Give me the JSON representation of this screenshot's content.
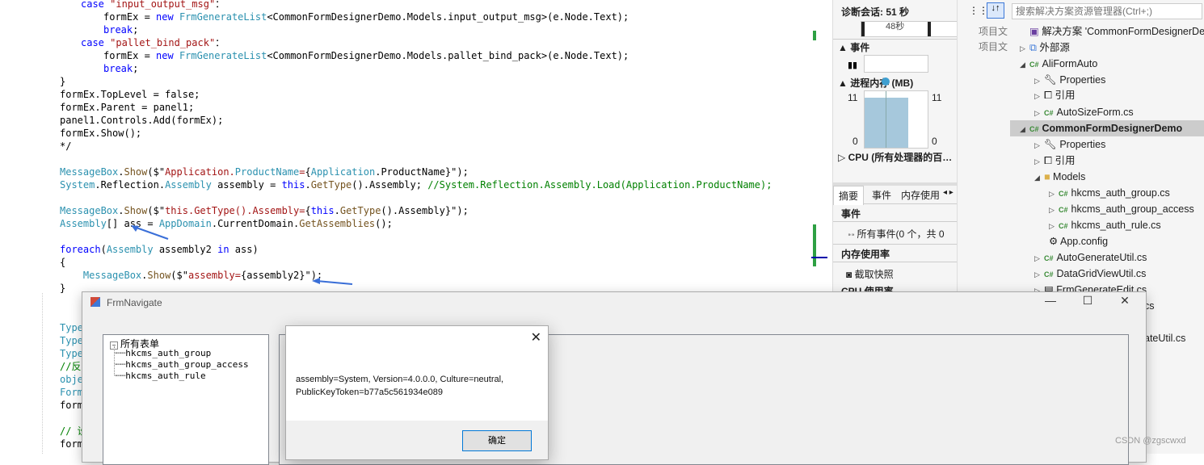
{
  "editor": {
    "lines": [
      {
        "segments": [
          [
            "kw",
            "case "
          ],
          [
            "st",
            "\"input_output_msg\""
          ],
          [
            "",
            "："
          ]
        ]
      },
      {
        "segments": [
          [
            "",
            "formEx = "
          ],
          [
            "kw",
            "new "
          ],
          [
            "ty",
            "FrmGenerateList"
          ],
          [
            "",
            "<CommonFormDesignerDemo.Models.input_output_msg>(e.Node.Text);"
          ]
        ]
      },
      {
        "segments": [
          [
            "kw",
            "break"
          ],
          [
            "",
            ";"
          ]
        ]
      },
      {
        "segments": [
          [
            "kw",
            "case "
          ],
          [
            "st",
            "\"pallet_bind_pack\""
          ],
          [
            "",
            "："
          ]
        ]
      },
      {
        "segments": [
          [
            "",
            "formEx = "
          ],
          [
            "kw",
            "new "
          ],
          [
            "ty",
            "FrmGenerateList"
          ],
          [
            "",
            "<CommonFormDesignerDemo.Models.pallet_bind_pack>(e.Node.Text);"
          ]
        ]
      },
      {
        "segments": [
          [
            "kw",
            "break"
          ],
          [
            "",
            ";"
          ]
        ]
      },
      {
        "segments": [
          [
            "",
            "}"
          ]
        ]
      },
      {
        "segments": [
          [
            "",
            "formEx.TopLevel = false;"
          ]
        ]
      },
      {
        "segments": [
          [
            "",
            "formEx.Parent = panel1;"
          ]
        ]
      },
      {
        "segments": [
          [
            "",
            "panel1.Controls.Add(formEx);"
          ]
        ]
      },
      {
        "segments": [
          [
            "",
            "formEx.Show();"
          ]
        ]
      },
      {
        "segments": [
          [
            "",
            "*/"
          ]
        ]
      },
      {
        "segments": [
          [
            "",
            ""
          ]
        ]
      },
      {
        "segments": [
          [
            "ty",
            "MessageBox"
          ],
          [
            "",
            "."
          ],
          [
            "fn",
            "Show"
          ],
          [
            "",
            "($\""
          ],
          [
            "st",
            "Application."
          ],
          [
            "ty",
            "ProductName"
          ],
          [
            "st",
            "="
          ],
          [
            "",
            "{"
          ],
          [
            "ty",
            "Application"
          ],
          [
            "",
            ".ProductName}\");"
          ]
        ]
      },
      {
        "segments": [
          [
            "ty",
            "System"
          ],
          [
            "",
            ".Reflection."
          ],
          [
            "ty",
            "Assembly"
          ],
          [
            "",
            " assembly = "
          ],
          [
            "kw",
            "this"
          ],
          [
            "",
            "."
          ],
          [
            "fn",
            "GetType"
          ],
          [
            "",
            "().Assembly; "
          ],
          [
            "cm",
            "//System.Reflection.Assembly.Load(Application.ProductName);"
          ]
        ]
      },
      {
        "segments": [
          [
            "",
            ""
          ]
        ]
      },
      {
        "segments": [
          [
            "ty",
            "MessageBox"
          ],
          [
            "",
            "."
          ],
          [
            "fn",
            "Show"
          ],
          [
            "",
            "($\""
          ],
          [
            "st",
            "this.GetType().Assembly="
          ],
          [
            "",
            "{"
          ],
          [
            "kw",
            "this"
          ],
          [
            "",
            "."
          ],
          [
            "fn",
            "GetType"
          ],
          [
            "",
            "().Assembly}\");"
          ]
        ]
      },
      {
        "segments": [
          [
            "ty",
            "Assembly"
          ],
          [
            "",
            "[] ass = "
          ],
          [
            "ty",
            "AppDomain"
          ],
          [
            "",
            ".CurrentDomain."
          ],
          [
            "fn",
            "GetAssemblies"
          ],
          [
            "",
            "();"
          ]
        ]
      },
      {
        "segments": [
          [
            "",
            ""
          ]
        ]
      },
      {
        "segments": [
          [
            "kw",
            "foreach"
          ],
          [
            "",
            "("
          ],
          [
            "ty",
            "Assembly"
          ],
          [
            "",
            " assembly2 "
          ],
          [
            "kw",
            "in"
          ],
          [
            "",
            " ass)"
          ]
        ]
      },
      {
        "segments": [
          [
            "",
            "{"
          ]
        ]
      },
      {
        "segments": [
          [
            "",
            "    "
          ],
          [
            "ty",
            "MessageBox"
          ],
          [
            "",
            "."
          ],
          [
            "fn",
            "Show"
          ],
          [
            "",
            "($\""
          ],
          [
            "st",
            "assembly="
          ],
          [
            "",
            "{assembly2}\");"
          ]
        ]
      },
      {
        "segments": [
          [
            "",
            "}"
          ]
        ]
      }
    ],
    "lower_lines": [
      "Type",
      "Type",
      "Type",
      "//反",
      "obje",
      "Form",
      "form",
      "",
      "// 设",
      "form"
    ]
  },
  "diagnostics": {
    "session_label": "诊断会话: 51 秒",
    "timeline_label": "48秒",
    "events_header": "事件",
    "memory_header": "进程内存 (MB)",
    "mem_max_left": "11",
    "mem_max_right": "11",
    "mem_min_left": "0",
    "mem_min_right": "0",
    "cpu_header": "CPU (所有处理器的百…",
    "tabs": [
      "摘要",
      "事件",
      "内存使用"
    ],
    "events_section": "事件",
    "all_events": "所有事件(0 个，共 0",
    "mem_usage_section": "内存使用率",
    "snapshot_button": "截取快照",
    "cpu_section": "CPU 使用率"
  },
  "midstrip": {
    "item1": "项目文",
    "item2": "项目文"
  },
  "solution_explorer": {
    "search_placeholder": "搜索解决方案资源管理器(Ctrl+;)",
    "items": [
      {
        "label": "解决方案 'CommonFormDesignerDe",
        "icon": "solution-icon"
      },
      {
        "label": "外部源",
        "icon": "external-icon"
      },
      {
        "label": "AliFormAuto",
        "icon": "csproj-icon"
      },
      {
        "label": "Properties",
        "icon": "wrench-icon"
      },
      {
        "label": "引用",
        "icon": "reference-icon"
      },
      {
        "label": "AutoSizeForm.cs",
        "icon": "cs-file-icon"
      },
      {
        "label": "CommonFormDesignerDemo",
        "icon": "csproj-icon"
      },
      {
        "label": "Properties",
        "icon": "wrench-icon"
      },
      {
        "label": "引用",
        "icon": "reference-icon"
      },
      {
        "label": "Models",
        "icon": "folder-icon"
      },
      {
        "label": "hkcms_auth_group.cs",
        "icon": "cs-file-icon"
      },
      {
        "label": "hkcms_auth_group_access",
        "icon": "cs-file-icon"
      },
      {
        "label": "hkcms_auth_rule.cs",
        "icon": "cs-file-icon"
      },
      {
        "label": "App.config",
        "icon": "config-icon"
      },
      {
        "label": "AutoGenerateUtil.cs",
        "icon": "cs-file-icon"
      },
      {
        "label": "DataGridViewUtil.cs",
        "icon": "cs-file-icon"
      },
      {
        "label": "FrmGenerateEdit.cs",
        "icon": "cs-file-icon"
      }
    ],
    "partial_1": "cs",
    "partial_2": "ateUtil.cs"
  },
  "frm_navigate": {
    "title": "FrmNavigate",
    "minimize": "—",
    "maximize": "☐",
    "close": "✕",
    "tree": {
      "root": "所有表单",
      "children": [
        "hkcms_auth_group",
        "hkcms_auth_group_access",
        "hkcms_auth_rule"
      ]
    }
  },
  "message_box": {
    "text": "assembly=System, Version=4.0.0.0, Culture=neutral, PublicKeyToken=b77a5c561934e089",
    "ok_label": "确定",
    "close": "✕"
  },
  "watermark": "CSDN @zgscwxd"
}
